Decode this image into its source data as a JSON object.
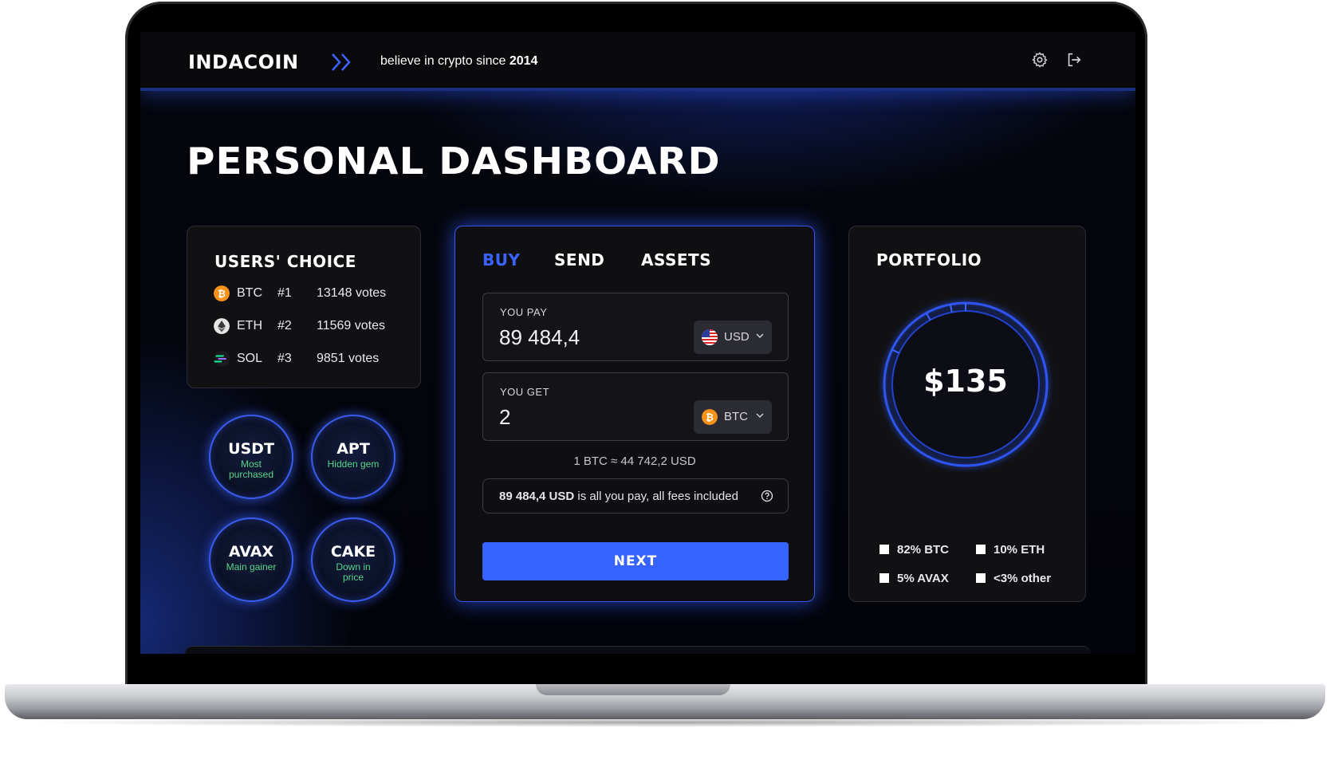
{
  "header": {
    "logo": "INDACOIN",
    "tagline_text": "believe in crypto since ",
    "tagline_year": "2014",
    "settings_icon": "gear-icon",
    "logout_icon": "logout-icon"
  },
  "page_title": "PERSONAL DASHBOARD",
  "users_choice": {
    "title": "USERS' CHOICE",
    "rows": [
      {
        "symbol": "BTC",
        "rank": "#1",
        "votes": "13148 votes",
        "color": "#f7931a"
      },
      {
        "symbol": "ETH",
        "rank": "#2",
        "votes": "11569 votes",
        "color": "#e6e6e6"
      },
      {
        "symbol": "SOL",
        "rank": "#3",
        "votes": "9851 votes",
        "color": "#14f195"
      }
    ]
  },
  "bubbles": [
    {
      "title": "USDT",
      "subtitle": "Most purchased"
    },
    {
      "title": "APT",
      "subtitle": "Hidden gem"
    },
    {
      "title": "AVAX",
      "subtitle": "Main gainer"
    },
    {
      "title": "CAKE",
      "subtitle": "Down in price"
    }
  ],
  "exchange": {
    "tabs": [
      "BUY",
      "SEND",
      "ASSETS"
    ],
    "active_tab": "BUY",
    "pay_label": "YOU PAY",
    "pay_value": "89 484,4",
    "pay_currency": "USD",
    "get_label": "YOU GET",
    "get_value": "2",
    "get_currency": "BTC",
    "rate": "1 BTC ≈ 44 742,2 USD",
    "fee_amount": "89 484,4 USD",
    "fee_text": " is all you pay, all fees included",
    "next_label": "NEXT"
  },
  "portfolio": {
    "title": "PORTFOLIO",
    "total": "$135",
    "legend": [
      "82% BTC",
      "10% ETH",
      "5% AVAX",
      "<3% other"
    ],
    "shares": [
      82,
      10,
      5,
      3
    ]
  },
  "colors": {
    "accent": "#3663ff",
    "bubble_subtitle": "#57d68a",
    "btc": "#f7931a"
  }
}
